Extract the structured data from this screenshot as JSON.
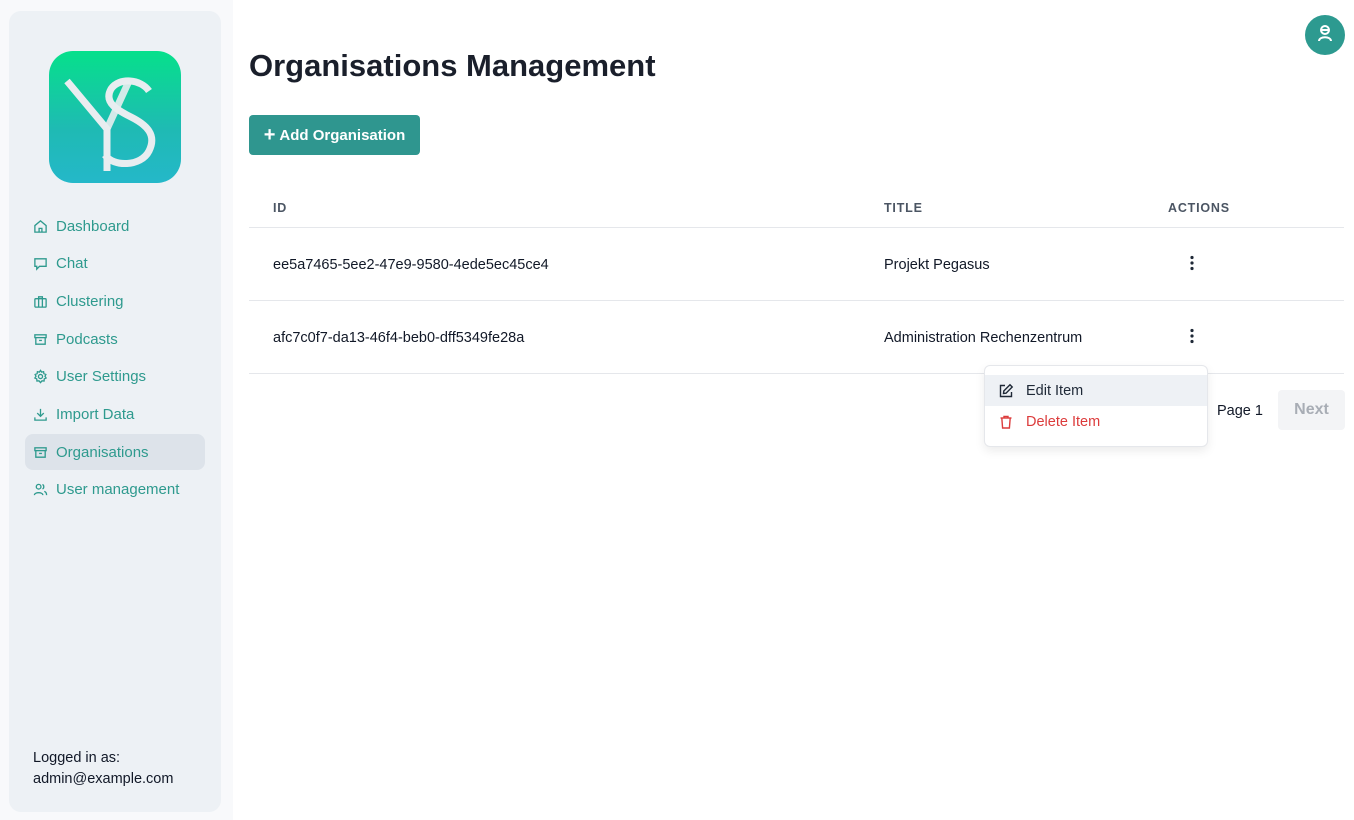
{
  "sidebar": {
    "logo_text": "YS",
    "items": [
      {
        "label": "Dashboard",
        "icon": "home-icon"
      },
      {
        "label": "Chat",
        "icon": "chat-icon"
      },
      {
        "label": "Clustering",
        "icon": "briefcase-icon"
      },
      {
        "label": "Podcasts",
        "icon": "archive-icon"
      },
      {
        "label": "User Settings",
        "icon": "gear-icon"
      },
      {
        "label": "Import Data",
        "icon": "download-icon"
      },
      {
        "label": "Organisations",
        "icon": "archive-icon",
        "active": true
      },
      {
        "label": "User management",
        "icon": "users-icon"
      }
    ],
    "logged_in_label": "Logged in as:",
    "logged_in_user": "admin@example.com"
  },
  "header": {
    "title": "Organisations Management",
    "add_button": "Add Organisation"
  },
  "table": {
    "columns": [
      "ID",
      "TITLE",
      "ACTIONS"
    ],
    "rows": [
      {
        "id": "ee5a7465-5ee2-47e9-9580-4ede5ec45ce4",
        "title": "Projekt Pegasus"
      },
      {
        "id": "afc7c0f7-da13-46f4-beb0-dff5349fe28a",
        "title": "Administration Rechenzentrum"
      }
    ]
  },
  "pagination": {
    "page_label": "Page 1",
    "next_label": "Next"
  },
  "context_menu": {
    "edit_label": "Edit Item",
    "delete_label": "Delete Item"
  },
  "colors": {
    "accent": "#2f968f",
    "danger": "#dc3b3b",
    "sidebar_bg": "#edf1f5"
  }
}
